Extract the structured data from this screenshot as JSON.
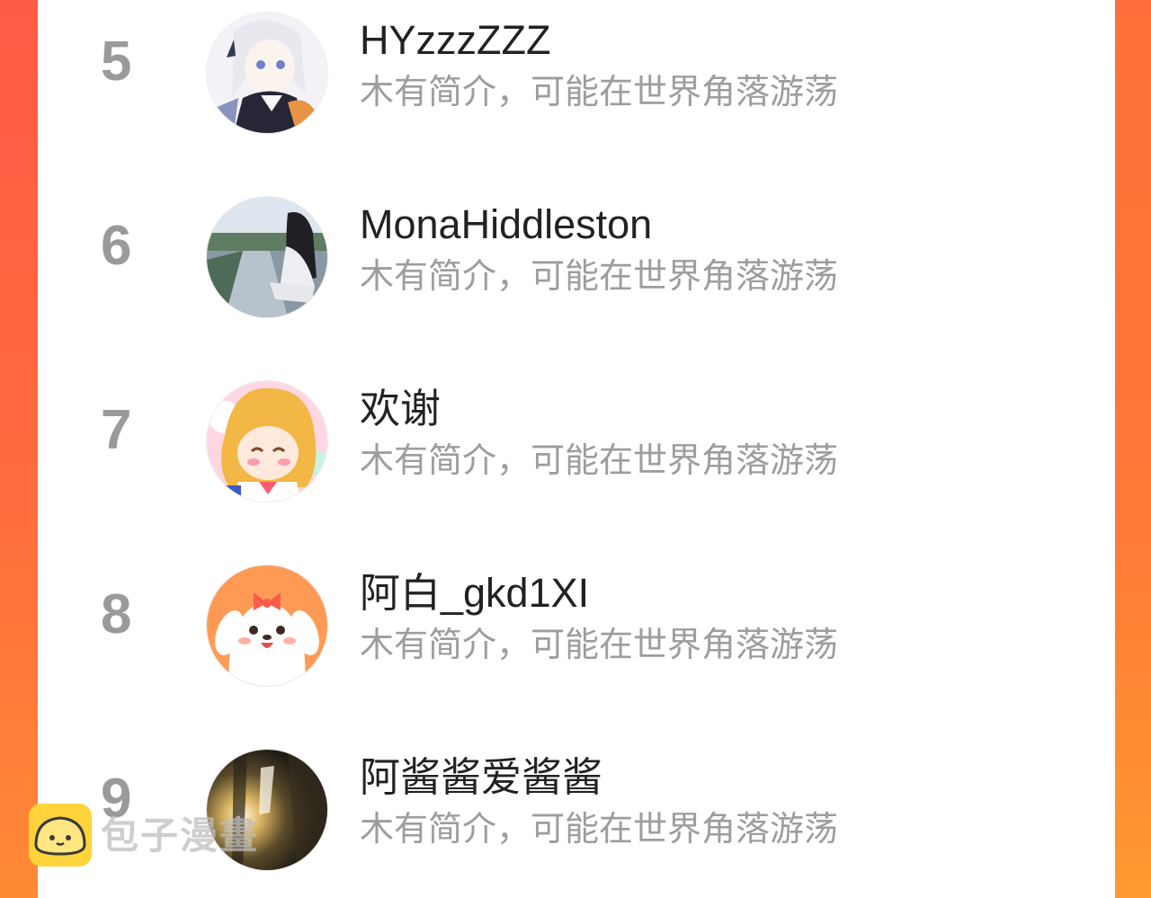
{
  "ranking": {
    "rows": [
      {
        "rank": "5",
        "username": "HYzzzZZZ",
        "bio": "木有简介，可能在世界角落游荡"
      },
      {
        "rank": "6",
        "username": "MonaHiddleston",
        "bio": "木有简介，可能在世界角落游荡"
      },
      {
        "rank": "7",
        "username": "欢谢",
        "bio": "木有简介，可能在世界角落游荡"
      },
      {
        "rank": "8",
        "username": "阿白_gkd1XI",
        "bio": "木有简介，可能在世界角落游荡"
      },
      {
        "rank": "9",
        "username": "阿酱酱爱酱酱",
        "bio": "木有简介，可能在世界角落游荡"
      }
    ]
  },
  "watermark": {
    "text": "包子漫畫",
    "logo_icon": "bun-logo-icon"
  },
  "colors": {
    "background_left": "#ff5a45",
    "background_right": "#ff8a35",
    "rank_gray": "#9a9a9a",
    "username": "#222222",
    "bio_gray": "#9d9d9d",
    "watermark_yellow": "#ffd43a"
  }
}
